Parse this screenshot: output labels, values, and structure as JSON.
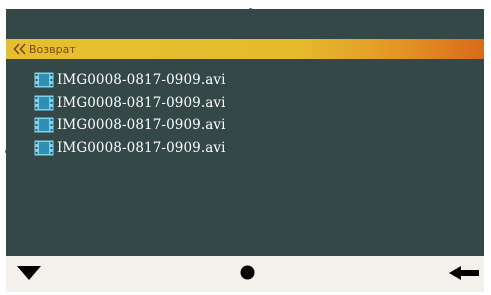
{
  "header": {
    "back_label": "Возврат"
  },
  "files": [
    {
      "name": "IMG0008-0817-0909.avi",
      "icon": "video-file-icon"
    },
    {
      "name": "IMG0008-0817-0909.avi",
      "icon": "video-file-icon"
    },
    {
      "name": "IMG0008-0817-0909.avi",
      "icon": "video-file-icon"
    },
    {
      "name": "IMG0008-0817-0909.avi",
      "icon": "video-file-icon"
    }
  ],
  "navigation": {
    "down_icon": "triangle-down-icon",
    "home_icon": "circle-icon",
    "back_icon": "arrow-left-icon"
  },
  "colors": {
    "background": "#354848",
    "back_bar_start": "#e6bf2e",
    "back_bar_end": "#d96a1a",
    "file_icon": "#7fd0ea",
    "nav_bar": "#f4f0ec"
  }
}
